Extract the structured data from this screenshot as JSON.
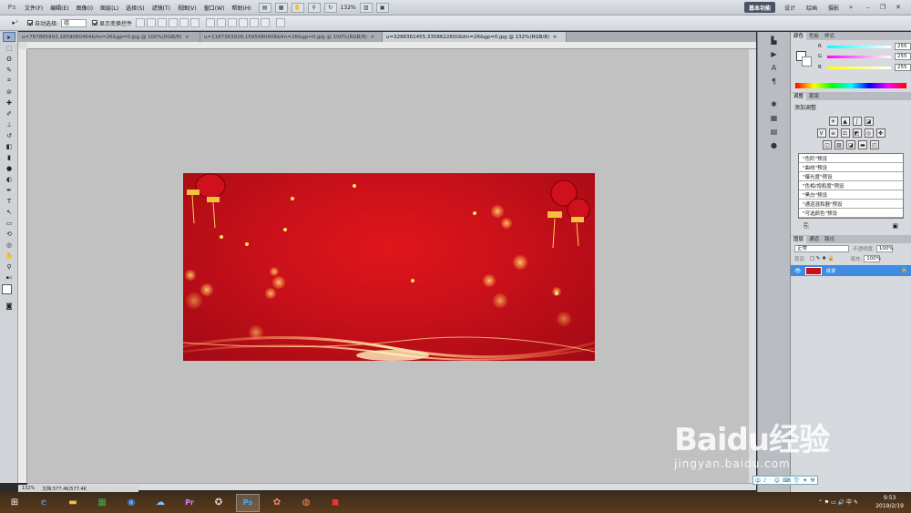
{
  "app": {
    "logo": "Ps"
  },
  "menu": [
    "文件(F)",
    "编辑(E)",
    "图像(I)",
    "图层(L)",
    "选择(S)",
    "滤镜(T)",
    "视图(V)",
    "窗口(W)",
    "帮助(H)"
  ],
  "zoom": "132%",
  "workspaces": [
    "基本功能",
    "设计",
    "绘画",
    "摄影"
  ],
  "options": {
    "auto_select": "自动选择:",
    "auto_select_value": "组",
    "show_transform": "显示变换控件"
  },
  "tabs": [
    {
      "label": "u=787885993,1859080464&fm=26&gp=0.jpg @ 100%(RGB/8)",
      "active": false
    },
    {
      "label": "u=1187363928,1695980908&fm=26&gp=0.jpg @ 100%(RGB/8)",
      "active": false
    },
    {
      "label": "u=3288361455,3358622600&fm=26&gp=0.jpg @ 132%(RGB/8)",
      "active": true
    }
  ],
  "status": {
    "zoom": "132%",
    "doc": "文档:577.4K/577.4K"
  },
  "color_panel": {
    "tabs": [
      "颜色",
      "色板",
      "样式"
    ],
    "r": "255",
    "g": "255",
    "b": "255",
    "r_label": "R",
    "g_label": "G",
    "b_label": "B"
  },
  "adjust_panel": {
    "tabs": [
      "调整",
      "蒙版"
    ],
    "title": "添加调整",
    "presets": [
      "\"色阶\"预设",
      "\"曲线\"预设",
      "\"曝光度\"预设",
      "\"色相/饱和度\"预设",
      "\"黑白\"预设",
      "\"通道混和器\"预设",
      "\"可选颜色\"预设"
    ]
  },
  "layers_panel": {
    "tabs": [
      "图层",
      "通道",
      "路径"
    ],
    "blend": "正常",
    "opacity_label": "不透明度:",
    "opacity": "100%",
    "lock_label": "锁定:",
    "fill_label": "填充:",
    "fill": "100%",
    "layer_name": "背景"
  },
  "watermark": {
    "logo": "Baidu经验",
    "sub": "jingyan.baidu.com"
  },
  "ime": [
    "中",
    "♪",
    "·",
    "☺",
    "⌨",
    "👕",
    "✦",
    "⚒"
  ],
  "clock": {
    "time": "9:53",
    "date": "2019/2/19"
  }
}
